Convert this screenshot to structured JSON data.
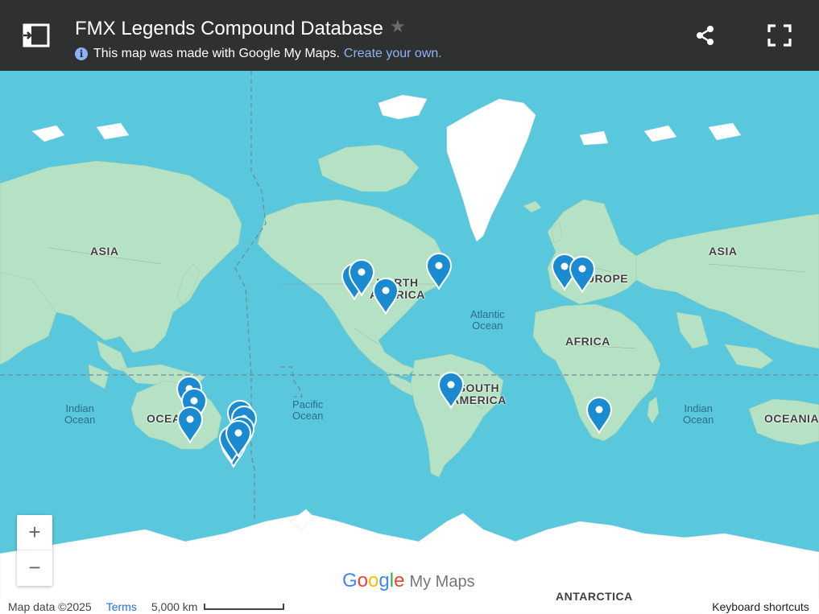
{
  "header": {
    "title": "FMX Legends Compound Database",
    "subtitle_text": "This map was made with Google My Maps.",
    "create_link": "Create your own."
  },
  "map": {
    "labels": {
      "asia_left": "ASIA",
      "asia_right": "ASIA",
      "north_america": "NORTH\nAMERICA",
      "europe": "EUROPE",
      "africa": "AFRICA",
      "south_america": "SOUTH\nAMERICA",
      "oceania_left": "OCEANIA",
      "oceania_right": "OCEANIA",
      "antarctica": "ANTARCTICA",
      "indian_ocean_left": "Indian\nOcean",
      "indian_ocean_right": "Indian\nOcean",
      "pacific_ocean": "Pacific\nOcean",
      "atlantic_ocean": "Atlantic\nOcean"
    },
    "pin_color": "#1a8ad1",
    "pin_count": 17
  },
  "controls": {
    "zoom_in": "+",
    "zoom_out": "−"
  },
  "branding": {
    "google": [
      "G",
      "o",
      "o",
      "g",
      "l",
      "e"
    ],
    "my_maps": "My Maps"
  },
  "footer": {
    "map_data": "Map data ©2025",
    "terms": "Terms",
    "scale": "5,000 km",
    "keyboard_shortcuts": "Keyboard shortcuts"
  }
}
